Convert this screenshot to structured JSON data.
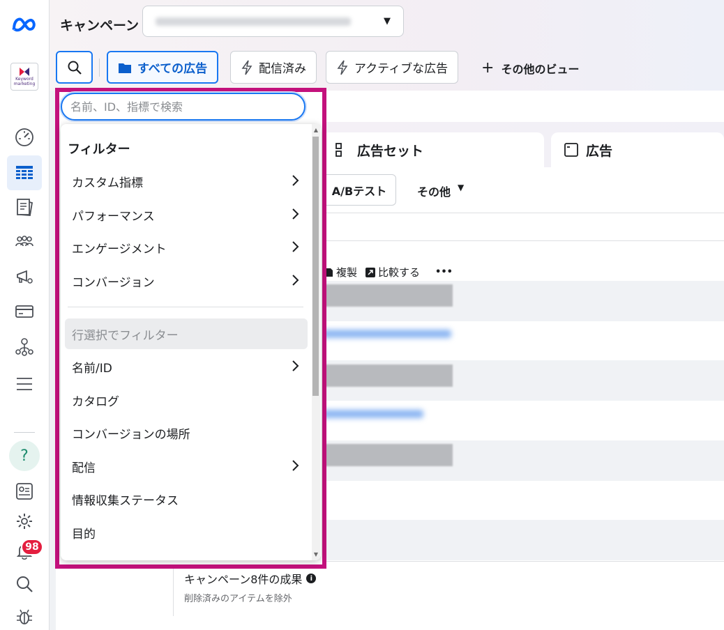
{
  "header": {
    "title": "キャンペーン",
    "campaign_select_caret": "▼"
  },
  "brand": {
    "line1": "Keyword",
    "line2": "marketing"
  },
  "toolbar": {
    "all_ads": "すべての広告",
    "delivered": "配信済み",
    "active_ads": "アクティブな広告",
    "more_views": "その他のビュー",
    "more_views_plus": "+"
  },
  "rail": {
    "notification_count": "98",
    "help_label": "?"
  },
  "tabs": {
    "adset": "広告セット",
    "ad": "広告"
  },
  "buttons": {
    "ab_test": "A/Bテスト",
    "other": "その他",
    "other_caret": "▼"
  },
  "row_actions": {
    "duplicate": "複製",
    "compare": "比較する",
    "more": "•••"
  },
  "summary": {
    "title": "キャンペーン8件の成果",
    "subtitle": "削除済みのアイテムを除外",
    "info_icon": "i"
  },
  "filter": {
    "search_placeholder": "名前、ID、指標で検索",
    "title": "フィルター",
    "items": [
      {
        "label": "カスタム指標",
        "chevron": true
      },
      {
        "label": "パフォーマンス",
        "chevron": true
      },
      {
        "label": "エンゲージメント",
        "chevron": true
      },
      {
        "label": "コンバージョン",
        "chevron": true
      },
      {
        "label": "行選択でフィルター",
        "chevron": false,
        "disabled": true
      },
      {
        "label": "名前/ID",
        "chevron": true
      },
      {
        "label": "カタログ",
        "chevron": false
      },
      {
        "label": "コンバージョンの場所",
        "chevron": false
      },
      {
        "label": "配信",
        "chevron": true
      },
      {
        "label": "情報収集ステータス",
        "chevron": false
      },
      {
        "label": "目的",
        "chevron": false
      }
    ]
  },
  "colors": {
    "highlight": "#c3117c",
    "accent": "#1877f2",
    "badge": "#e41e3f"
  }
}
